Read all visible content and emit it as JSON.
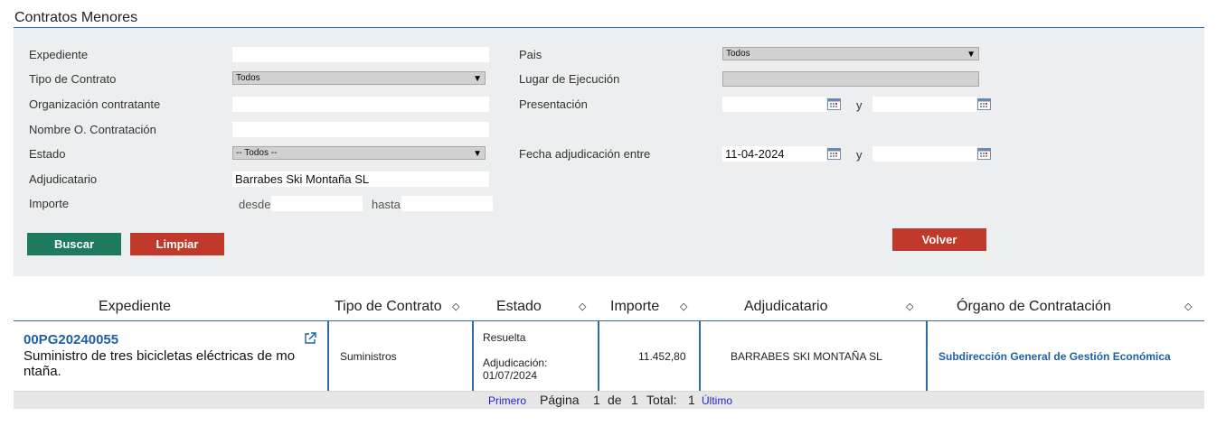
{
  "page_title": "Contratos Menores",
  "form": {
    "expediente_label": "Expediente",
    "tipo_label": "Tipo de Contrato",
    "tipo_value": "Todos",
    "organizacion_label": "Organización contratante",
    "nombre_label": "Nombre O. Contratación",
    "estado_label": "Estado",
    "estado_value": "-- Todos --",
    "adjudicatario_label": "Adjudicatario",
    "adjudicatario_value": "Barrabes Ski Montaña SL",
    "importe_label": "Importe",
    "desde_label": "desde",
    "hasta_label": "hasta",
    "pais_label": "Pais",
    "pais_value": "Todos",
    "lugar_label": "Lugar de Ejecución",
    "presentacion_label": "Presentación",
    "y_label": "y",
    "fecha_label": "Fecha adjudicación entre",
    "fecha_desde_value": "11-04-2024",
    "buscar_label": "Buscar",
    "limpiar_label": "Limpiar",
    "volver_label": "Volver"
  },
  "table": {
    "headers": [
      "Expediente",
      "Tipo de Contrato",
      "Estado",
      "Importe",
      "Adjudicatario",
      "Órgano de Contratación"
    ],
    "sort_glyph": "◇",
    "row": {
      "expediente": "00PG20240055",
      "descripcion": "Suministro de tres bicicletas eléctricas de mo ntaña.",
      "tipo": "Suministros",
      "estado": "Resuelta",
      "adjudicacion_label": "Adjudicación:",
      "adjudicacion_fecha": "01/07/2024",
      "importe": "11.452,80",
      "adjudicatario": "BARRABES SKI MONTAÑA SL",
      "organo": "Subdirección General de Gestión Económica"
    }
  },
  "pager": {
    "primero": "Primero",
    "pagina_label": "Página",
    "pagina": "1",
    "de_label": "de",
    "total_paginas": "1",
    "total_label": "Total:",
    "total": "1",
    "ultimo": "Último"
  },
  "colors": {
    "accent": "#2b6ca8",
    "buscar": "#1e7a5f",
    "limpiar": "#c0392b",
    "link": "#1f5fa8"
  },
  "icons": [
    "calendar-icon",
    "external-link-icon",
    "sort-icon",
    "chevron-down-icon"
  ]
}
